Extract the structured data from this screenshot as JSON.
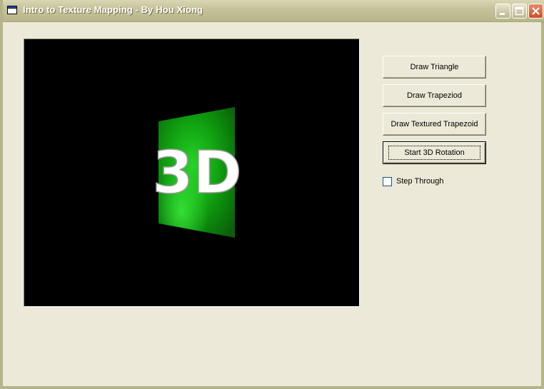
{
  "window": {
    "title": "Intro to Texture Mapping - By Hou Xiong",
    "icon": "app-window-icon",
    "controls": [
      "minimize-icon",
      "maximize-icon",
      "close-icon"
    ]
  },
  "viewport": {
    "background": "#000000",
    "texture_text": "3D",
    "texture_color": "#14c814"
  },
  "buttons": {
    "draw_triangle": "Draw Triangle",
    "draw_trapezoid": "Draw Trapeziod",
    "draw_textured_trapezoid": "Draw Textured Trapezoid",
    "start_rotation": "Start 3D Rotation"
  },
  "options": {
    "step_through_label": "Step Through",
    "step_through_checked": false
  }
}
